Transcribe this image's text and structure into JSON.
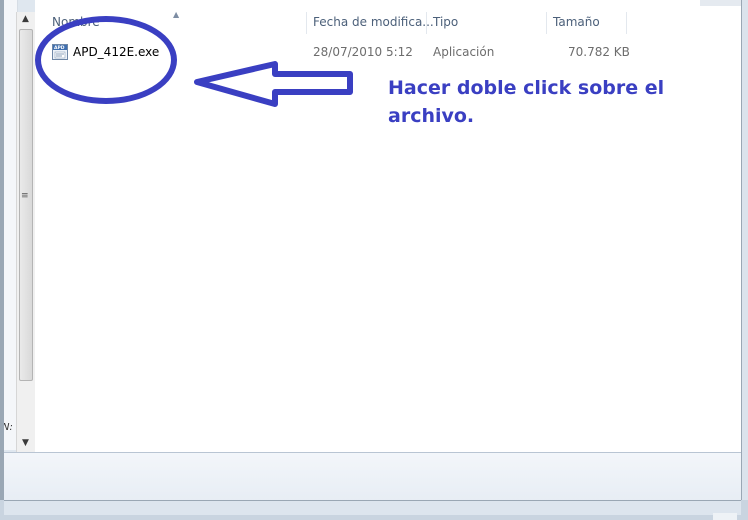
{
  "columns": {
    "name": "Nombre",
    "date": "Fecha de modifica...",
    "type": "Tipo",
    "size": "Tamaño"
  },
  "file": {
    "name": "APD_412E.exe",
    "date": "28/07/2010 5:12",
    "type": "Aplicación",
    "size": "70.782 KB",
    "icon": "application-exe-icon"
  },
  "annotation": {
    "text": "Hacer doble click sobre el archivo.",
    "color": "#3a3fc2"
  },
  "left_pane": {
    "cut_text": "N:"
  }
}
